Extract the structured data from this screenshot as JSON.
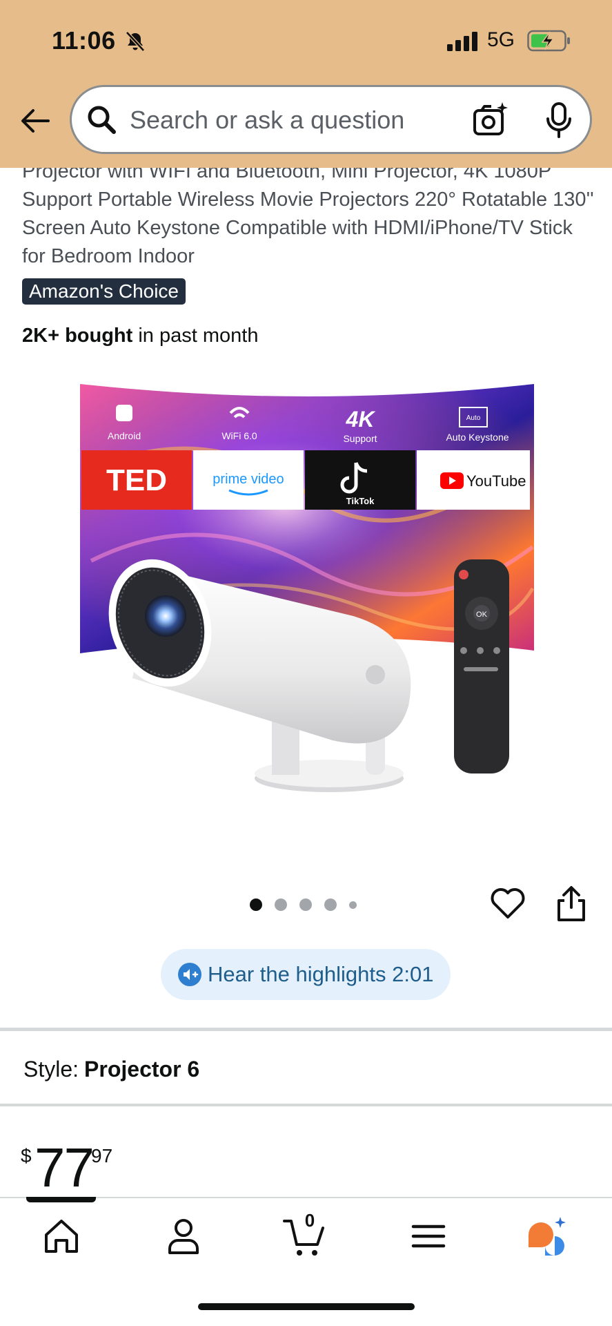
{
  "status_bar": {
    "time": "11:06",
    "network": "5G"
  },
  "search": {
    "placeholder": "Search or ask a question"
  },
  "product": {
    "title": "Projector with WIFI and Bluetooth, Mini Projector, 4K 1080P Support Portable Wireless Movie Projectors 220° Rotatable 130'' Screen Auto Keystone Compatible with HDMI/iPhone/TV Stick for Bedroom Indoor",
    "badge": "Amazon's Choice",
    "bought_count": "2K+ bought",
    "bought_suffix": " in past month",
    "image_features": [
      "Android",
      "WiFi 6.0",
      "Support",
      "Auto Keystone"
    ],
    "image_feature_4k": "4K",
    "image_feature_auto": "Auto",
    "image_apps": [
      "TED",
      "prime video",
      "TikTok",
      "YouTube"
    ],
    "remote_ok": "OK"
  },
  "carousel": {
    "slide_count": 5,
    "active_index": 0
  },
  "highlights": {
    "label": "Hear the highlights 2:01"
  },
  "style": {
    "label": "Style:",
    "value": "Projector 6"
  },
  "price": {
    "symbol": "$",
    "whole": "77",
    "fraction": "97"
  },
  "bottom_nav": {
    "items": [
      "home-icon",
      "account-icon",
      "cart-icon",
      "menu-icon",
      "rufus-icon"
    ],
    "cart_count": "0"
  },
  "colors": {
    "header_bg": "#e6bd8a",
    "badge_bg": "#232f3e",
    "highlight_bg": "#e4f0fb",
    "highlight_text": "#1f5d8c"
  }
}
